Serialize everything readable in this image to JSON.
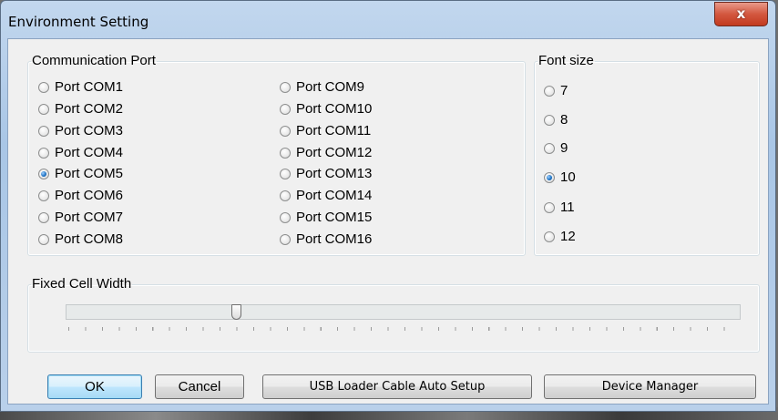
{
  "window": {
    "title": "Environment Setting",
    "close_glyph": "x"
  },
  "communication_port": {
    "legend": "Communication Port",
    "ports": [
      "Port COM1",
      "Port COM2",
      "Port COM3",
      "Port COM4",
      "Port COM5",
      "Port COM6",
      "Port COM7",
      "Port COM8",
      "Port COM9",
      "Port COM10",
      "Port COM11",
      "Port COM12",
      "Port COM13",
      "Port COM14",
      "Port COM15",
      "Port COM16"
    ],
    "selected": "Port COM5"
  },
  "font_size": {
    "legend": "Font size",
    "options": [
      "7",
      "8",
      "9",
      "10",
      "11",
      "12"
    ],
    "selected": "10"
  },
  "fixed_cell_width": {
    "legend": "Fixed Cell Width",
    "slider_fraction": 0.25
  },
  "buttons": {
    "ok": "OK",
    "cancel": "Cancel",
    "usb_setup": "USB Loader Cable Auto Setup",
    "device_manager": "Device Manager"
  },
  "colors": {
    "close_button": "#c9432a",
    "default_button_border": "#3c7fb1",
    "selected_radio": "#1a6fc0"
  }
}
